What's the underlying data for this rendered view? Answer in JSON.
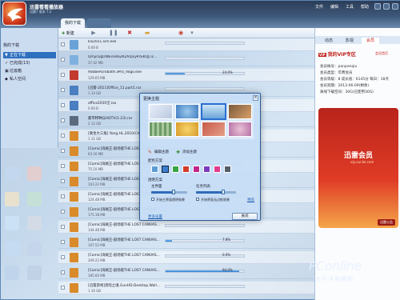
{
  "app": {
    "title": "迅雷看看播放器",
    "subtitle": "迅雷7 版本 7.2"
  },
  "menu": [
    "文件",
    "编辑",
    "工具",
    "帮助"
  ],
  "tabs": {
    "active": "我的下载",
    "inactive": ""
  },
  "sidebar": {
    "header": "我的下载",
    "items": [
      {
        "label": "正在下载",
        "active": true
      },
      {
        "label": "已完成(13)",
        "active": false
      },
      {
        "label": "垃圾箱",
        "active": false
      },
      {
        "label": "私人空间",
        "active": false
      }
    ]
  },
  "toolbar": {
    "new_label": "新建"
  },
  "downloads": [
    {
      "name": "kis2011.sch.exe",
      "size": "0.00 B",
      "pct": "",
      "fill": 0,
      "color": "#6aa2d8"
    },
    {
      "name": "QmycxgOWEnHs6ZK2hrpsyPcEKQJ7Z...",
      "size": "37.42 MB",
      "pct": "",
      "fill": 0,
      "color": "#7fb0e0"
    },
    {
      "name": "AdobeAcrobat9.3Pro_Vogo.exe",
      "size": "129.65 MB",
      "pct": "24.0%",
      "fill": 24,
      "color": "#c33b2e"
    },
    {
      "name": "[迅雷-2011]Office_11.part1.rar",
      "size": "1.14 GB",
      "pct": "",
      "fill": 0,
      "color": "#4a7fc1"
    },
    {
      "name": "office2010全.iso",
      "size": "0.00 B",
      "pct": "",
      "fill": 0,
      "color": "#4a7fc1"
    },
    {
      "name": "都市特种兵HDTV(1-23).rar",
      "size": "2.12 GB",
      "pct": "",
      "fill": 0,
      "color": "#5b6b7d"
    },
    {
      "name": "[黄金大三角].Yong.HL.2010(Ch...",
      "size": "1.11 GB",
      "pct": "",
      "fill": 0,
      "color": "#d98a2a"
    },
    {
      "name": "[Comic]海贼王-剧场版THE LOST CANVAS...",
      "size": "63.16 MB",
      "pct": "",
      "fill": 0,
      "color": "#d98a2a"
    },
    {
      "name": "[Comic]海贼王-剧场版THE LOST CANVAS...",
      "size": "75.10 MB",
      "pct": "",
      "fill": 0,
      "color": "#d98a2a"
    },
    {
      "name": "[Comic]海贼王-剧场版THE LOST CANVAS...",
      "size": "103.22 MB",
      "pct": "",
      "fill": 0,
      "color": "#d98a2a"
    },
    {
      "name": "[Comic]海贼王-剧场版THE LOST CANVAS...",
      "size": "124.48 MB",
      "pct": "",
      "fill": 0,
      "color": "#d98a2a"
    },
    {
      "name": "[Comic]海贼王-剧场版THE LOST CANVAS...",
      "size": "175.18 MB",
      "pct": "",
      "fill": 0,
      "color": "#d98a2a"
    },
    {
      "name": "[Comic]海贼王-剧场版THE LOST CANVAS...",
      "size": "144.48 MB",
      "pct": "",
      "fill": 0,
      "color": "#d98a2a"
    },
    {
      "name": "[Comic]海贼王-剧场版THE LOST CANVAS...",
      "size": "167.52 MB",
      "pct": "7.8%",
      "fill": 8,
      "color": "#d98a2a"
    },
    {
      "name": "[Comic]海贼王-剧场版THE LOST CANVAS...",
      "size": "209.22 MB",
      "pct": "0.0%",
      "fill": 0,
      "color": "#d98a2a"
    },
    {
      "name": "[Comic]海贼王-剧场版THE LOST CANVAS...",
      "size": "185.60 MB",
      "pct": "94.0%",
      "fill": 94,
      "color": "#d98a2a"
    },
    {
      "name": "[迅雷游戏]黑暗之魂.GunHD.Desktop.Wall...",
      "size": "1.16 GB",
      "pct": "",
      "fill": 0,
      "color": "#d98a2a"
    }
  ],
  "rpanel": {
    "tabs": [
      "动态",
      "影视",
      "会员"
    ],
    "vip_title": "我的VIP专区",
    "vip_link": "会员首页",
    "lines": [
      "会员帐号：panpanqiu",
      "会员类型：年费会员",
      "会员等级：8  成长值：6145分  每日：18点",
      "会员到期：2013-06-09(剩余)",
      "离线下载空间：30G(已使用30G)"
    ],
    "ad_logo": "迅雷会员",
    "ad_url": "vip.xunlei.com",
    "ad_btn": "迅雷公告"
  },
  "watermark": {
    "brand": "PConline",
    "sub": "太平洋电脑网"
  },
  "dialog": {
    "title": "更换主题",
    "edit_theme": "编辑主题",
    "add_theme": "添加主题",
    "color_scheme": "配色方案",
    "transparency": "透明方案",
    "main_area": "主界面",
    "task_list": "任务列表",
    "cb1": "开始主界面透明效果",
    "cb2": "开始界面无边框效果",
    "preview": "预览",
    "more": "更多设置",
    "close": "关闭"
  }
}
